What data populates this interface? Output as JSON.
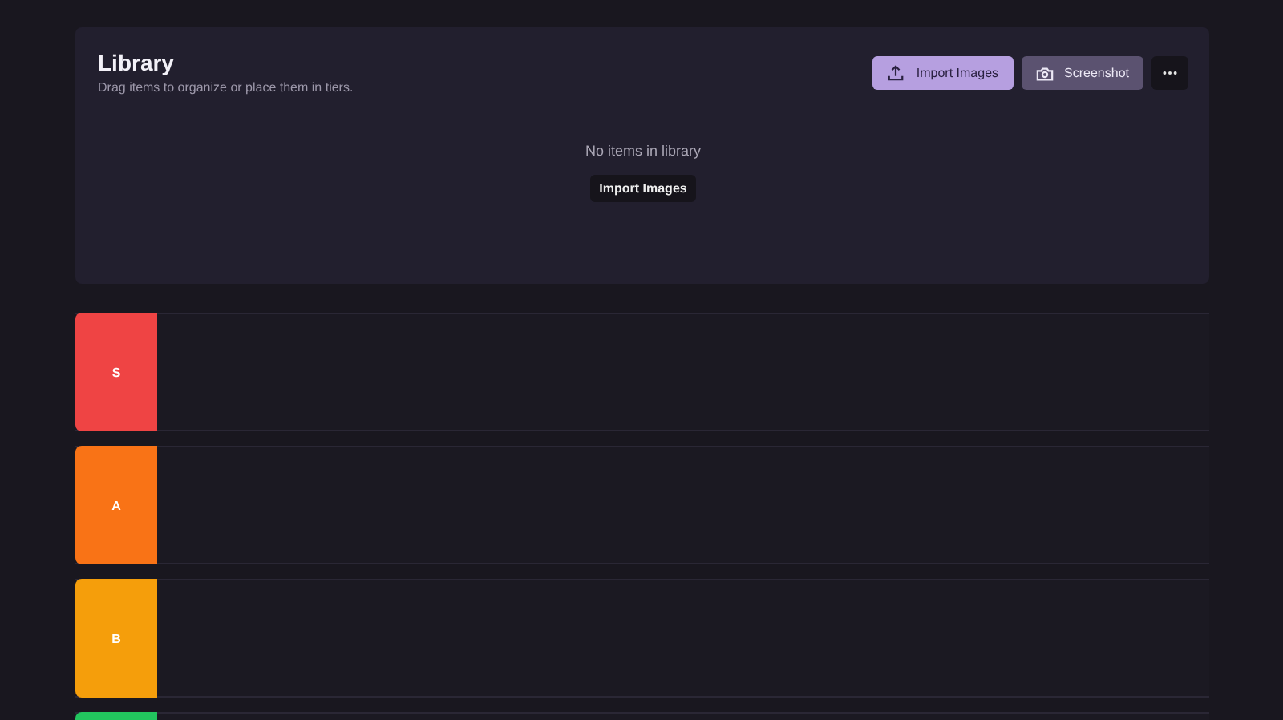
{
  "library": {
    "title": "Library",
    "subtitle": "Drag items to organize or place them in tiers.",
    "actions": [
      {
        "kind": "primary",
        "label": "Import Images"
      },
      {
        "kind": "secondary",
        "label": "Screenshot"
      },
      {
        "kind": "more"
      }
    ],
    "empty_message": "No items in library",
    "empty_button": "Import Images"
  },
  "tiers": [
    {
      "label": "S",
      "color": "#ef4444"
    },
    {
      "label": "A",
      "color": "#f97316"
    },
    {
      "label": "B",
      "color": "#f59e0b"
    },
    {
      "color": "#22c55e"
    }
  ]
}
